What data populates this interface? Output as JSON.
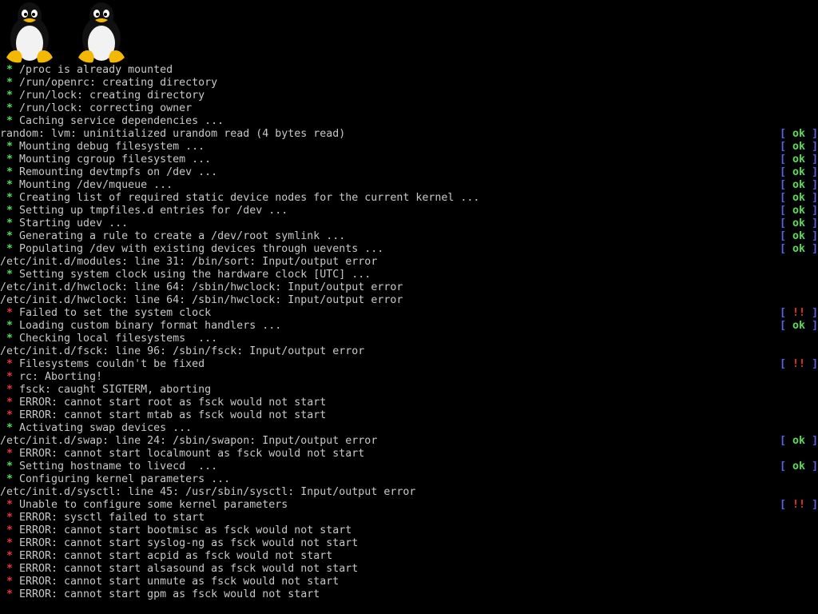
{
  "colors": {
    "background": "#000000",
    "text": "#c8c8c8",
    "ok_bullet": "#55dd55",
    "error_bullet": "#ee3333",
    "bracket": "#5566ee"
  },
  "logos": [
    "tux-penguin-icon",
    "tux-penguin-icon"
  ],
  "status_brackets": {
    "open": "[",
    "close": "]"
  },
  "lines": [
    {
      "bullet": "*",
      "kind": "ok",
      "text": "/proc is already mounted",
      "status": ""
    },
    {
      "bullet": "*",
      "kind": "ok",
      "text": "/run/openrc: creating directory",
      "status": ""
    },
    {
      "bullet": "*",
      "kind": "ok",
      "text": "/run/lock: creating directory",
      "status": ""
    },
    {
      "bullet": "*",
      "kind": "ok",
      "text": "/run/lock: correcting owner",
      "status": ""
    },
    {
      "bullet": "*",
      "kind": "ok",
      "text": "Caching service dependencies ...",
      "status": ""
    },
    {
      "bullet": "",
      "kind": "raw",
      "text": "random: lvm: uninitialized urandom read (4 bytes read)",
      "status": "ok"
    },
    {
      "bullet": "*",
      "kind": "ok",
      "text": "Mounting debug filesystem ...",
      "status": "ok"
    },
    {
      "bullet": "*",
      "kind": "ok",
      "text": "Mounting cgroup filesystem ...",
      "status": "ok"
    },
    {
      "bullet": "*",
      "kind": "ok",
      "text": "Remounting devtmpfs on /dev ...",
      "status": "ok"
    },
    {
      "bullet": "*",
      "kind": "ok",
      "text": "Mounting /dev/mqueue ...",
      "status": "ok"
    },
    {
      "bullet": "*",
      "kind": "ok",
      "text": "Creating list of required static device nodes for the current kernel ...",
      "status": "ok"
    },
    {
      "bullet": "*",
      "kind": "ok",
      "text": "Setting up tmpfiles.d entries for /dev ...",
      "status": "ok"
    },
    {
      "bullet": "*",
      "kind": "ok",
      "text": "Starting udev ...",
      "status": "ok"
    },
    {
      "bullet": "*",
      "kind": "ok",
      "text": "Generating a rule to create a /dev/root symlink ...",
      "status": "ok"
    },
    {
      "bullet": "*",
      "kind": "ok",
      "text": "Populating /dev with existing devices through uevents ...",
      "status": "ok"
    },
    {
      "bullet": "",
      "kind": "raw",
      "text": "/etc/init.d/modules: line 31: /bin/sort: Input/output error",
      "status": ""
    },
    {
      "bullet": "*",
      "kind": "ok",
      "text": "Setting system clock using the hardware clock [UTC] ...",
      "status": ""
    },
    {
      "bullet": "",
      "kind": "raw",
      "text": "/etc/init.d/hwclock: line 64: /sbin/hwclock: Input/output error",
      "status": ""
    },
    {
      "bullet": "",
      "kind": "raw",
      "text": "/etc/init.d/hwclock: line 64: /sbin/hwclock: Input/output error",
      "status": ""
    },
    {
      "bullet": "*",
      "kind": "err",
      "text": "Failed to set the system clock",
      "status": "!!"
    },
    {
      "bullet": "*",
      "kind": "ok",
      "text": "Loading custom binary format handlers ...",
      "status": "ok"
    },
    {
      "bullet": "*",
      "kind": "ok",
      "text": "Checking local filesystems  ...",
      "status": ""
    },
    {
      "bullet": "",
      "kind": "raw",
      "text": "/etc/init.d/fsck: line 96: /sbin/fsck: Input/output error",
      "status": ""
    },
    {
      "bullet": "*",
      "kind": "err",
      "text": "Filesystems couldn't be fixed",
      "status": "!!"
    },
    {
      "bullet": "*",
      "kind": "err",
      "text": "rc: Aborting!",
      "status": ""
    },
    {
      "bullet": "*",
      "kind": "err",
      "text": "fsck: caught SIGTERM, aborting",
      "status": ""
    },
    {
      "bullet": "*",
      "kind": "err",
      "text": "ERROR: cannot start root as fsck would not start",
      "status": ""
    },
    {
      "bullet": "*",
      "kind": "err",
      "text": "ERROR: cannot start mtab as fsck would not start",
      "status": ""
    },
    {
      "bullet": "*",
      "kind": "ok",
      "text": "Activating swap devices ...",
      "status": ""
    },
    {
      "bullet": "",
      "kind": "raw",
      "text": "/etc/init.d/swap: line 24: /sbin/swapon: Input/output error",
      "status": "ok"
    },
    {
      "bullet": "*",
      "kind": "err",
      "text": "ERROR: cannot start localmount as fsck would not start",
      "status": ""
    },
    {
      "bullet": "*",
      "kind": "ok",
      "text": "Setting hostname to livecd  ...",
      "status": "ok"
    },
    {
      "bullet": "*",
      "kind": "ok",
      "text": "Configuring kernel parameters ...",
      "status": ""
    },
    {
      "bullet": "",
      "kind": "raw",
      "text": "/etc/init.d/sysctl: line 45: /usr/sbin/sysctl: Input/output error",
      "status": ""
    },
    {
      "bullet": "*",
      "kind": "err",
      "text": "Unable to configure some kernel parameters",
      "status": "!!"
    },
    {
      "bullet": "*",
      "kind": "err",
      "text": "ERROR: sysctl failed to start",
      "status": ""
    },
    {
      "bullet": "*",
      "kind": "err",
      "text": "ERROR: cannot start bootmisc as fsck would not start",
      "status": ""
    },
    {
      "bullet": "*",
      "kind": "err",
      "text": "ERROR: cannot start syslog-ng as fsck would not start",
      "status": ""
    },
    {
      "bullet": "*",
      "kind": "err",
      "text": "ERROR: cannot start acpid as fsck would not start",
      "status": ""
    },
    {
      "bullet": "*",
      "kind": "err",
      "text": "ERROR: cannot start alsasound as fsck would not start",
      "status": ""
    },
    {
      "bullet": "*",
      "kind": "err",
      "text": "ERROR: cannot start unmute as fsck would not start",
      "status": ""
    },
    {
      "bullet": "*",
      "kind": "err",
      "text": "ERROR: cannot start gpm as fsck would not start",
      "status": ""
    }
  ]
}
